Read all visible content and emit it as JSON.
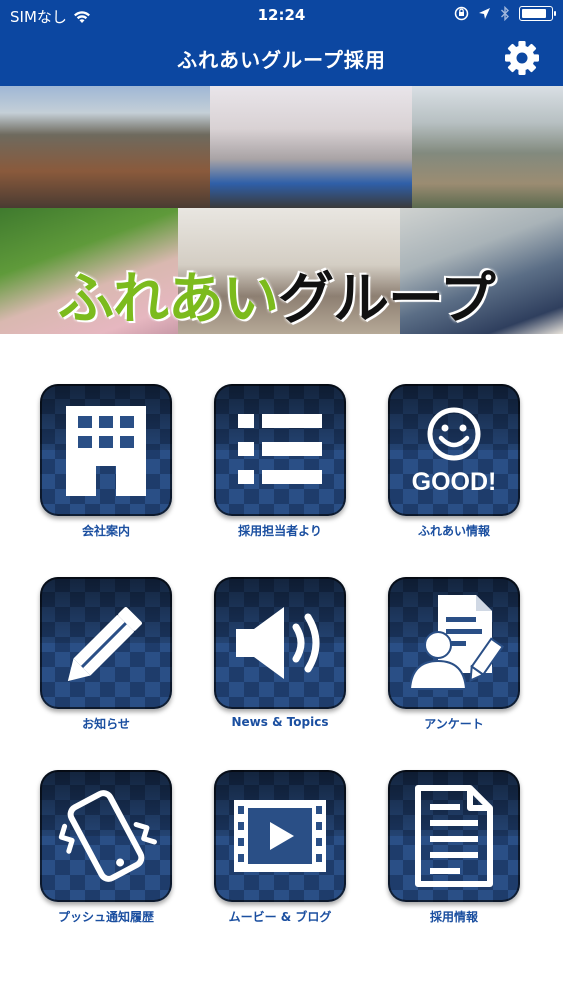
{
  "status_bar": {
    "carrier": "SIMなし",
    "time": "12:24",
    "battery_level": 0.9
  },
  "nav": {
    "title": "ふれあいグループ採用",
    "settings_icon": "gear-icon"
  },
  "banner": {
    "text_green": "ふれあい",
    "text_black": "グループ"
  },
  "menu": [
    {
      "label": "会社案内",
      "icon": "building-icon"
    },
    {
      "label": "採用担当者より",
      "icon": "list-icon"
    },
    {
      "label": "ふれあい情報",
      "icon": "good-smile-icon",
      "icon_text": "GOOD!"
    },
    {
      "label": "お知らせ",
      "icon": "pencil-icon"
    },
    {
      "label": "News & Topics",
      "icon": "speaker-icon"
    },
    {
      "label": "アンケート",
      "icon": "survey-icon"
    },
    {
      "label": "プッシュ通知履歴",
      "icon": "vibrating-phone-icon"
    },
    {
      "label": "ムービー & ブログ",
      "icon": "film-icon"
    },
    {
      "label": "採用情報",
      "icon": "document-icon"
    }
  ],
  "colors": {
    "header": "#0c47a1",
    "label": "#1b4fa0",
    "tile_light": "#2a4f86",
    "tile_dark": "#1e3c6b"
  }
}
